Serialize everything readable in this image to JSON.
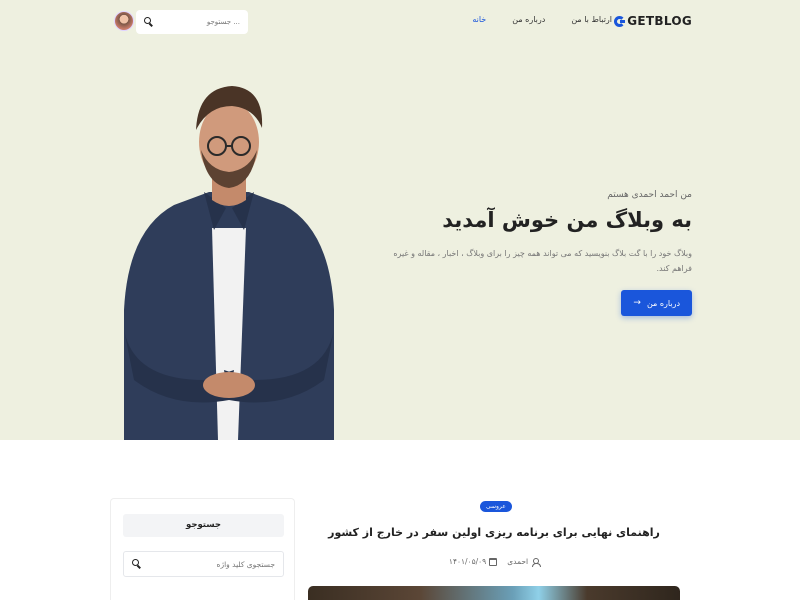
{
  "nav": {
    "logo": "GETBLOG",
    "menu": [
      {
        "label": "خانه",
        "active": true
      },
      {
        "label": "درباره من",
        "active": false
      },
      {
        "label": "ارتباط با من",
        "active": false
      }
    ],
    "search_placeholder": "جستوجو ..."
  },
  "hero": {
    "subtitle": "من احمد احمدی هستم",
    "title": "به وبلاگ من خوش آمدید",
    "description": "وبلاگ خود را با گت بلاگ بنویسید که می تواند همه چیز را برای وبلاگ ، اخبار ، مقاله و غیره فراهم کند.",
    "button_label": "درباره من",
    "button_arrow": "→"
  },
  "sidebar": {
    "heading": "جستوجو",
    "search_placeholder": "جستجوی کلید واژه"
  },
  "post": {
    "badge": "عروسی",
    "title": "راهنمای نهایی برای برنامه ریزی اولین سفر در خارج از کشور",
    "author": "احمدی",
    "date": "۱۴۰۱/۰۵/۰۹"
  },
  "colors": {
    "accent": "#1a56db",
    "hero_bg": "#eef0e0"
  }
}
